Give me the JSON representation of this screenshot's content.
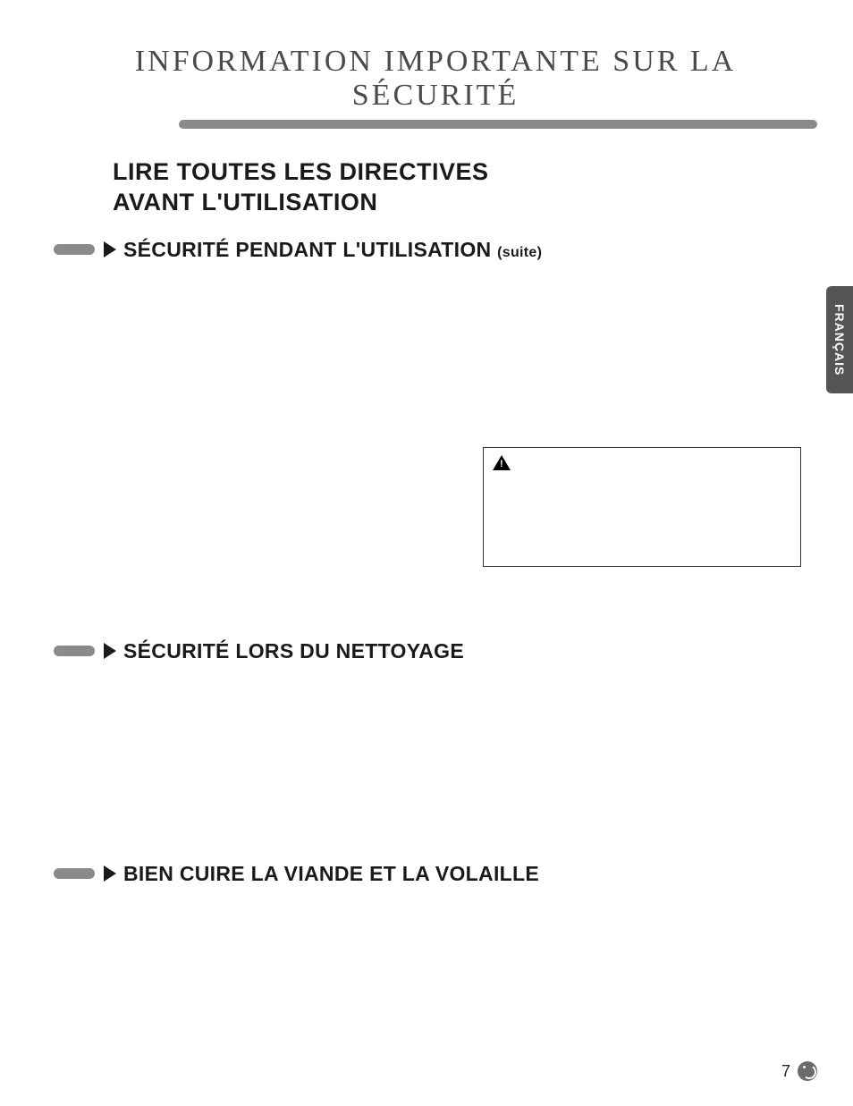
{
  "page_title": "INFORMATION IMPORTANTE SUR LA SÉCURITÉ",
  "directive_line1": "LIRE TOUTES LES DIRECTIVES",
  "directive_line2": "AVANT L'UTILISATION",
  "sections": {
    "s1_title": "SÉCURITÉ PENDANT L'UTILISATION",
    "s1_suffix": "(suite)",
    "s2_title": "SÉCURITÉ LORS DU NETTOYAGE",
    "s3_title": "BIEN CUIRE LA VIANDE ET LA VOLAILLE"
  },
  "side_tab": "FRANÇAIS",
  "page_number": "7",
  "logo_name": "lg-logo",
  "attention_icon": "warning-triangle-icon"
}
